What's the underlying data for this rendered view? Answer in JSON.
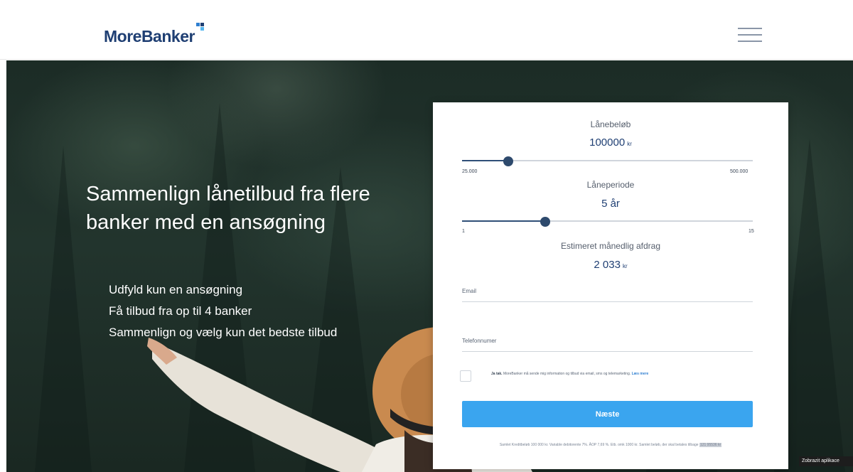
{
  "header": {
    "logo_text": "MoreBanker"
  },
  "hero": {
    "title": "Sammenlign lånetilbud fra flere banker med en ansøgning",
    "bullets": [
      "Udfyld kun en ansøgning",
      "Få tilbud fra op til 4 banker",
      "Sammenlign og vælg kun det bedste tilbud"
    ]
  },
  "form": {
    "loan_amount": {
      "label": "Lånebeløb",
      "value": "100000",
      "unit": "kr",
      "min_label": "25.000",
      "max_label": "500.000",
      "min": 25000,
      "max": 500000,
      "current": 100000
    },
    "loan_period": {
      "label": "Låneperiode",
      "value": "5 år",
      "min_label": "1",
      "max_label": "15",
      "min": 1,
      "max": 15,
      "current": 5
    },
    "monthly": {
      "label": "Estimeret månedlig afdrag",
      "value": "2 033",
      "unit": "kr"
    },
    "email_placeholder": "Email",
    "phone_placeholder": "Telefonnumer",
    "consent": {
      "lead": "Ja tak.",
      "text": "MoreBanker må sende mig information og tilbud via email, sms og telemarketing.",
      "link": "Læs mere"
    },
    "next_button": "Næste",
    "disclaimer_text": "Samlet Kreditbeløb 100 000 kr. Variable debitorente 7%. ÅOP 7,69 %. Etb. omk 1000 kr. Samlet beløb, der skal betales tilbage",
    "disclaimer_amount": "121 95536 kr"
  },
  "corner_badge": "Zobrazit aplikace",
  "colors": {
    "brand": "#1f3f73",
    "button": "#3aa5ef",
    "slider_thumb": "#2e4a6d"
  }
}
